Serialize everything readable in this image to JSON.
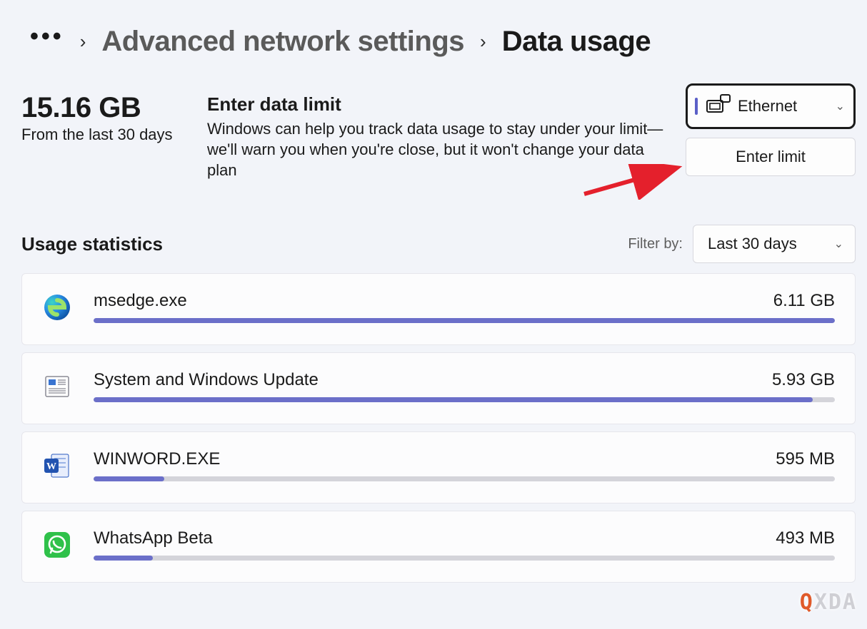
{
  "breadcrumb": {
    "prev": "Advanced network settings",
    "current": "Data usage"
  },
  "summary": {
    "total": "15.16 GB",
    "period": "From the last 30 days",
    "limit_title": "Enter data limit",
    "limit_desc": "Windows can help you track data usage to stay under your limit—we'll warn you when you're close, but it won't change your data plan"
  },
  "controls": {
    "adapter": "Ethernet",
    "enter_limit": "Enter limit"
  },
  "stats": {
    "header": "Usage statistics",
    "filter_label": "Filter by:",
    "filter_value": "Last 30 days"
  },
  "apps": [
    {
      "name": "msedge.exe",
      "size": "6.11 GB",
      "pct": 100,
      "icon": "edge"
    },
    {
      "name": "System and Windows Update",
      "size": "5.93 GB",
      "pct": 97,
      "icon": "update"
    },
    {
      "name": "WINWORD.EXE",
      "size": "595 MB",
      "pct": 9.5,
      "icon": "word"
    },
    {
      "name": "WhatsApp Beta",
      "size": "493 MB",
      "pct": 8,
      "icon": "whatsapp"
    }
  ],
  "watermark": {
    "q": "Q",
    "rest": "XDA"
  }
}
